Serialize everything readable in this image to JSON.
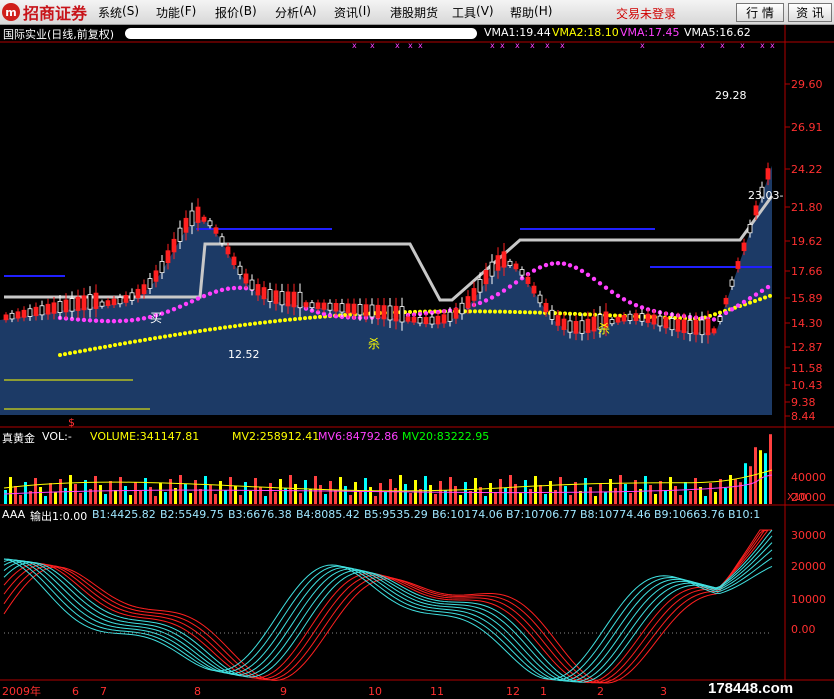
{
  "menubar": {
    "logo_text": "招商证券",
    "items": [
      {
        "label": "系统",
        "key": "S"
      },
      {
        "label": "功能",
        "key": "F"
      },
      {
        "label": "报价",
        "key": "B"
      },
      {
        "label": "分析",
        "key": "A"
      },
      {
        "label": "资讯",
        "key": "I"
      },
      {
        "label": "港股期货",
        "key": ""
      },
      {
        "label": "工具",
        "key": "V"
      },
      {
        "label": "帮助",
        "key": "H"
      }
    ],
    "status": "交易未登录",
    "buttons": [
      "行 情",
      "资 讯"
    ]
  },
  "main_chart": {
    "title": "国际实业(日线,前复权)",
    "indicators": [
      {
        "label": "VMA1:19.44",
        "color": "#ffffff"
      },
      {
        "label": "VMA2:18.10",
        "color": "#ffff00"
      },
      {
        "label": "VMA:17.45",
        "color": "#ff40ff"
      },
      {
        "label": "VMA5:16.62",
        "color": "#00ff00"
      }
    ],
    "y_ticks": [
      "29.60",
      "26.91",
      "24.22",
      "21.80",
      "19.62",
      "17.66",
      "15.89",
      "14.30",
      "12.87",
      "11.58",
      "10.43",
      "9.38",
      "8.44"
    ],
    "annotations": {
      "high": "29.28",
      "low": "12.52",
      "mid": "23.03-"
    },
    "labels": {
      "buy": "买",
      "sell": "杀",
      "dollar": "$"
    }
  },
  "volume_panel": {
    "title": "真黄金",
    "items": [
      {
        "label": "VOL:-",
        "color": "#ffffff"
      },
      {
        "label": "VOLUME:341147.81",
        "color": "#ffff00"
      },
      {
        "label": "MV2:258912.41",
        "color": "#ffff00"
      },
      {
        "label": "MV6:84792.86",
        "color": "#ff40ff"
      },
      {
        "label": "MV20:83222.95",
        "color": "#00ff00"
      }
    ],
    "y_ticks": [
      "40000",
      "20000"
    ],
    "scale_label": "X10"
  },
  "aaa_panel": {
    "title": "AAA",
    "items": [
      "输出1:0.00",
      "B1:4425.82",
      "B2:5549.75",
      "B3:6676.38",
      "B4:8085.42",
      "B5:9535.29",
      "B6:10174.06",
      "B7:10706.77",
      "B8:10774.46",
      "B9:10663.76",
      "B10:1"
    ],
    "y_ticks": [
      "30000",
      "20000",
      "10000",
      "0.00"
    ]
  },
  "x_axis": {
    "labels": [
      "2009年",
      "6",
      "7",
      "8",
      "9",
      "10",
      "11",
      "12",
      "1",
      "2",
      "3"
    ]
  },
  "watermark": "178448.com",
  "colors": {
    "up": "#ff2020",
    "down": "#00c8ff",
    "area": "#1c3a66",
    "background": "#000000",
    "axis": "#b00000"
  }
}
